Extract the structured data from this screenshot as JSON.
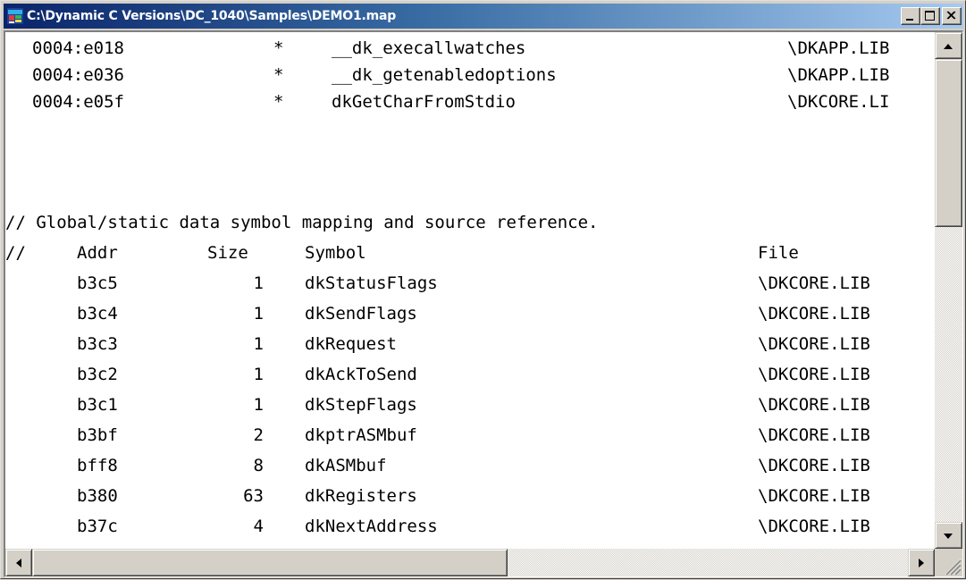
{
  "window": {
    "title": "C:\\Dynamic C Versions\\DC_1040\\Samples\\DEMO1.map",
    "icon": "dynamic-c-app-icon",
    "controls": [
      "minimize-icon",
      "maximize-icon",
      "close-icon"
    ]
  },
  "code_entries": [
    {
      "addr": "0004:e018",
      "marker": "*",
      "symbol": "__dk_execallwatches",
      "file": "\\DKAPP.LIB"
    },
    {
      "addr": "0004:e036",
      "marker": "*",
      "symbol": "__dk_getenabledoptions",
      "file": "\\DKAPP.LIB"
    },
    {
      "addr": "0004:e05f",
      "marker": "*",
      "symbol": "dkGetCharFromStdio",
      "file": "\\DKCORE.LI"
    }
  ],
  "section_comment": "// Global/static data symbol mapping and source reference.",
  "data_header": {
    "comment": "//",
    "addr": "Addr",
    "size": "Size",
    "symbol": "Symbol",
    "file": "File"
  },
  "data_entries": [
    {
      "addr": "b3c5",
      "size": "1",
      "symbol": "dkStatusFlags",
      "file": "\\DKCORE.LIB"
    },
    {
      "addr": "b3c4",
      "size": "1",
      "symbol": "dkSendFlags",
      "file": "\\DKCORE.LIB"
    },
    {
      "addr": "b3c3",
      "size": "1",
      "symbol": "dkRequest",
      "file": "\\DKCORE.LIB"
    },
    {
      "addr": "b3c2",
      "size": "1",
      "symbol": "dkAckToSend",
      "file": "\\DKCORE.LIB"
    },
    {
      "addr": "b3c1",
      "size": "1",
      "symbol": "dkStepFlags",
      "file": "\\DKCORE.LIB"
    },
    {
      "addr": "b3bf",
      "size": "2",
      "symbol": "dkptrASMbuf",
      "file": "\\DKCORE.LIB"
    },
    {
      "addr": "bff8",
      "size": "8",
      "symbol": "dkASMbuf",
      "file": "\\DKCORE.LIB"
    },
    {
      "addr": "b380",
      "size": "63",
      "symbol": "dkRegisters",
      "file": "\\DKCORE.LIB"
    },
    {
      "addr": "b37c",
      "size": "4",
      "symbol": "dkNextAddress",
      "file": "\\DKCORE.LIB"
    }
  ],
  "scrollbars": {
    "vertical": {
      "up": "scroll-up-arrow-icon",
      "down": "scroll-down-arrow-icon"
    },
    "horizontal": {
      "left": "scroll-left-arrow-icon",
      "right": "scroll-right-arrow-icon"
    }
  }
}
